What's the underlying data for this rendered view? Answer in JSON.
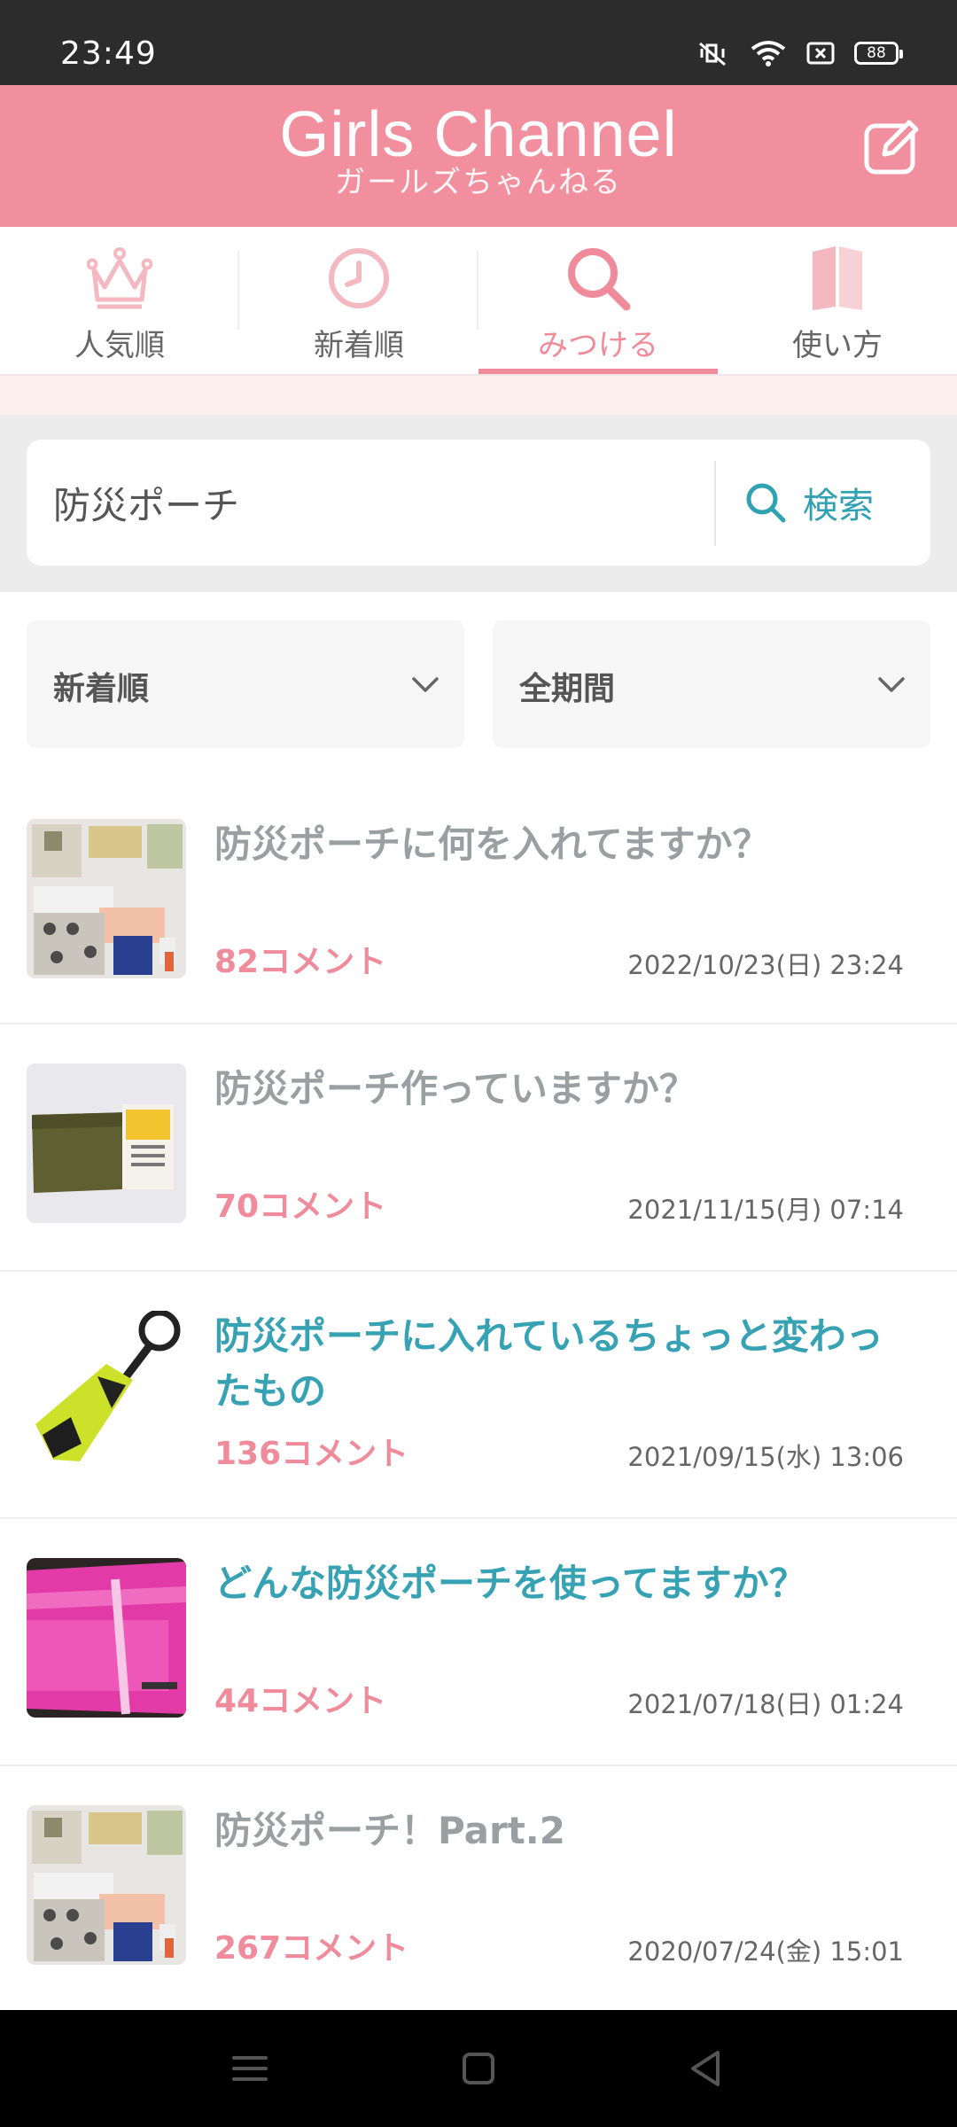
{
  "status_bar": {
    "time": "23:49",
    "battery": "88",
    "icons": [
      "mute-vibrate-icon",
      "wifi-icon",
      "sim-x-icon",
      "battery-icon"
    ]
  },
  "header": {
    "logo_main": "Girls Channel",
    "logo_sub": "ガールズちゃんねる",
    "compose_icon": "compose-icon",
    "background": "#f28f9e"
  },
  "tabs": [
    {
      "label": "人気順",
      "icon": "crown-icon",
      "active": false
    },
    {
      "label": "新着順",
      "icon": "clock-icon",
      "active": false
    },
    {
      "label": "みつける",
      "icon": "search-icon",
      "active": true
    },
    {
      "label": "使い方",
      "icon": "book-icon",
      "active": false
    }
  ],
  "search": {
    "value": "防災ポーチ",
    "button_label": "検索"
  },
  "filters": {
    "sort": "新着順",
    "period": "全期間"
  },
  "topics": [
    {
      "title": "防災ポーチに何を入れてますか？",
      "comments": "82コメント",
      "date": "2022/10/23(日) 23:24",
      "visited": true
    },
    {
      "title": "防災ポーチ作っていますか？",
      "comments": "70コメント",
      "date": "2021/11/15(月) 07:14",
      "visited": true
    },
    {
      "title": "防災ポーチに入れているちょっと変わったもの",
      "comments": "136コメント",
      "date": "2021/09/15(水) 13:06",
      "visited": false
    },
    {
      "title": "どんな防災ポーチを使ってますか？",
      "comments": "44コメント",
      "date": "2021/07/18(日) 01:24",
      "visited": false
    },
    {
      "title": "防災ポーチ！Part.2",
      "comments": "267コメント",
      "date": "2020/07/24(金) 15:01",
      "visited": true
    }
  ],
  "colors": {
    "accent_pink": "#ef8b9a",
    "link_blue": "#36a2b4",
    "visited_gray": "#9aa0a2"
  }
}
